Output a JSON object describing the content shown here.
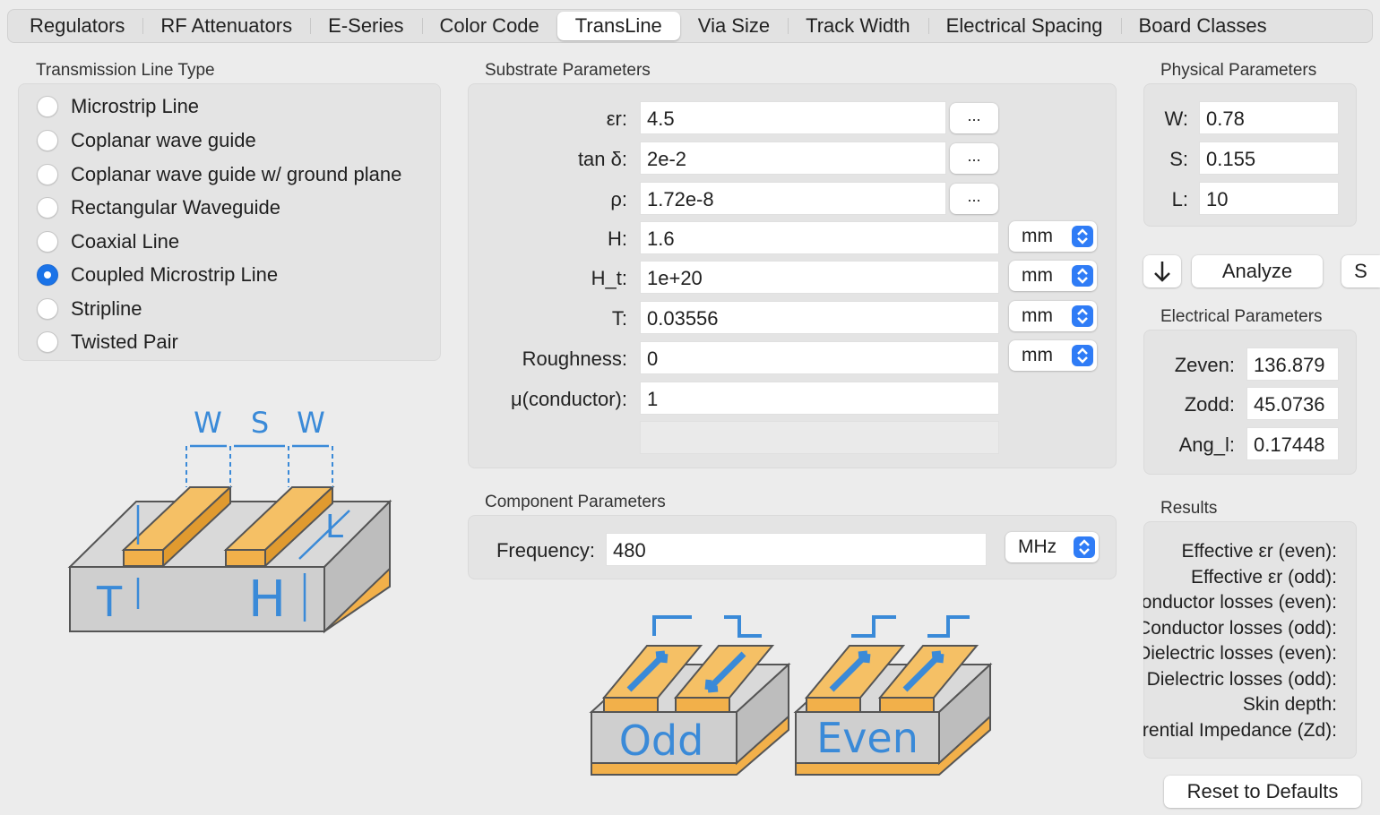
{
  "tabs": [
    "Regulators",
    "RF Attenuators",
    "E-Series",
    "Color Code",
    "TransLine",
    "Via Size",
    "Track Width",
    "Electrical Spacing",
    "Board Classes"
  ],
  "active_tab": "TransLine",
  "line_type": {
    "title": "Transmission Line Type",
    "options": [
      "Microstrip Line",
      "Coplanar wave guide",
      "Coplanar wave guide w/ ground plane",
      "Rectangular Waveguide",
      "Coaxial Line",
      "Coupled Microstrip Line",
      "Stripline",
      "Twisted Pair"
    ],
    "selected": "Coupled Microstrip Line"
  },
  "substrate": {
    "title": "Substrate Parameters",
    "er": {
      "label": "εr:",
      "value": "4.5",
      "btn": "..."
    },
    "tand": {
      "label": "tan δ:",
      "value": "2e-2",
      "btn": "..."
    },
    "rho": {
      "label": "ρ:",
      "value": "1.72e-8",
      "btn": "..."
    },
    "h": {
      "label": "H:",
      "value": "1.6",
      "unit": "mm"
    },
    "ht": {
      "label": "H_t:",
      "value": "1e+20",
      "unit": "mm"
    },
    "t": {
      "label": "T:",
      "value": "0.03556",
      "unit": "mm"
    },
    "roughness": {
      "label": "Roughness:",
      "value": "0",
      "unit": "mm"
    },
    "mu": {
      "label": "μ(conductor):",
      "value": "1"
    }
  },
  "component": {
    "title": "Component Parameters",
    "freq_label": "Frequency:",
    "freq_value": "480",
    "freq_unit": "MHz"
  },
  "physical": {
    "title": "Physical Parameters",
    "w": {
      "label": "W:",
      "value": "0.78"
    },
    "s": {
      "label": "S:",
      "value": "0.155"
    },
    "l": {
      "label": "L:",
      "value": "10"
    }
  },
  "actions": {
    "analyze": "Analyze",
    "synthesize": "S",
    "reset": "Reset to Defaults"
  },
  "electrical": {
    "title": "Electrical Parameters",
    "zeven": {
      "label": "Zeven:",
      "value": "136.879"
    },
    "zodd": {
      "label": "Zodd:",
      "value": "45.0736"
    },
    "ang": {
      "label": "Ang_l:",
      "value": "0.17448"
    }
  },
  "results": {
    "title": "Results",
    "lines": [
      "Effective εr (even):",
      "Effective εr (odd):",
      "Conductor losses (even):",
      "Conductor losses (odd):",
      "Dielectric losses (even):",
      "Dielectric losses (odd):",
      "Skin depth:",
      "Differential Impedance (Zd):"
    ]
  },
  "diagram": {
    "labels": {
      "w1": "W",
      "s": "S",
      "w2": "W",
      "l": "L",
      "t": "T",
      "h": "H"
    },
    "mode_odd": "Odd",
    "mode_even": "Even"
  },
  "colors": {
    "accent": "#2f7cf6",
    "copper": "#f2b04a",
    "diagram_blue": "#3a8ad8",
    "substrate": "#cfcfcf"
  }
}
